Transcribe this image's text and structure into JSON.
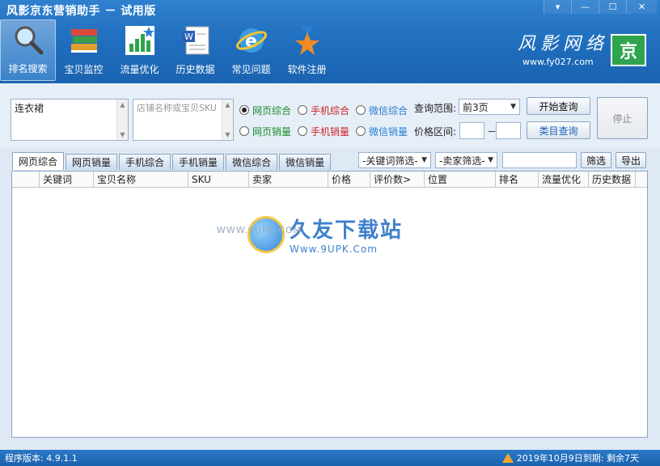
{
  "app": {
    "title": "风影京东营销助手 － 试用版",
    "window_controls": [
      "▾",
      "—",
      "☐",
      "✕"
    ]
  },
  "toolbar": [
    {
      "label": "排名搜索",
      "icon": "magnifier-icon",
      "active": true
    },
    {
      "label": "宝贝监控",
      "icon": "books-icon",
      "active": false
    },
    {
      "label": "流量优化",
      "icon": "bar-chart-icon",
      "active": false
    },
    {
      "label": "历史数据",
      "icon": "word-document-icon",
      "active": false
    },
    {
      "label": "常见问题",
      "icon": "ie-browser-icon",
      "active": false
    },
    {
      "label": "软件注册",
      "icon": "medal-star-icon",
      "active": false
    }
  ],
  "brand": {
    "name": "风影网络",
    "url": "www.fy027.com",
    "logo_text": "京"
  },
  "query": {
    "keyword_value": "连衣裙",
    "shop_placeholder": "店铺名称或宝贝SKU",
    "radios_row1": [
      {
        "label": "网页综合",
        "checked": true,
        "color": "#1a8c2a"
      },
      {
        "label": "手机综合",
        "checked": false,
        "color": "#cc2222"
      },
      {
        "label": "微信综合",
        "checked": false,
        "color": "#2a7fcf"
      }
    ],
    "radios_row2": [
      {
        "label": "网页销量",
        "checked": false,
        "color": "#1a8c2a"
      },
      {
        "label": "手机销量",
        "checked": false,
        "color": "#cc2222"
      },
      {
        "label": "微信销量",
        "checked": false,
        "color": "#2a7fcf"
      }
    ],
    "range_label": "查询范围:",
    "range_value": "前3页",
    "price_label": "价格区间:",
    "price_separator": "－",
    "start_button": "开始查询",
    "category_button": "类目查询",
    "stop_button": "停止"
  },
  "tabs": [
    "网页综合",
    "网页销量",
    "手机综合",
    "手机销量",
    "微信综合",
    "微信销量"
  ],
  "filters": {
    "keyword_filter": "-关键词筛选-",
    "seller_filter": "-卖家筛选-",
    "filter_button": "筛选",
    "export_button": "导出"
  },
  "table": {
    "columns": [
      "",
      "关键词",
      "宝贝名称",
      "SKU",
      "卖家",
      "价格",
      "评价数>",
      "位置",
      "排名",
      "流量优化",
      "历史数据"
    ]
  },
  "watermark": {
    "small": "WWW.9UPK.COM",
    "cn": "久友下载站",
    "url": "Www.9UPK.Com"
  },
  "status": {
    "version": "程序版本: 4.9.1.1",
    "expiry": "2019年10月9日到期: 剩余7天"
  }
}
